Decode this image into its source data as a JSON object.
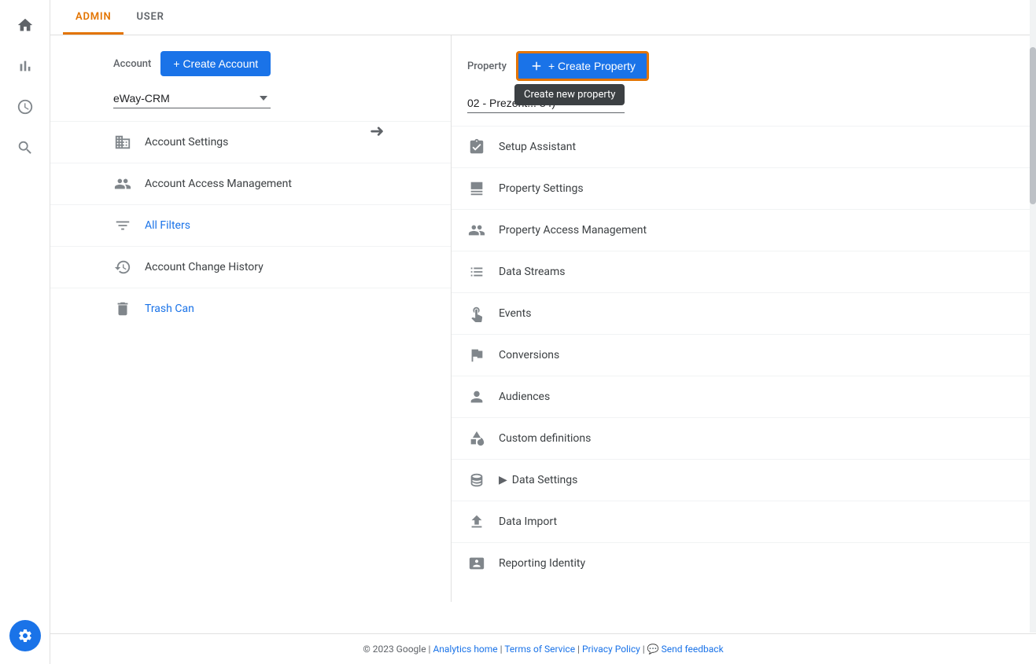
{
  "tabs": {
    "admin": "ADMIN",
    "user": "USER",
    "active": "admin"
  },
  "account_col": {
    "label": "Account",
    "create_btn": "+ Create Account",
    "dropdown_value": "eWay-CRM",
    "menu_items": [
      {
        "id": "account-settings",
        "label": "Account Settings",
        "icon": "building"
      },
      {
        "id": "account-access",
        "label": "Account Access Management",
        "icon": "people"
      },
      {
        "id": "all-filters",
        "label": "All Filters",
        "icon": "filter",
        "highlight": true
      },
      {
        "id": "account-change-history",
        "label": "Account Change History",
        "icon": "history"
      },
      {
        "id": "trash-can",
        "label": "Trash Can",
        "icon": "trash",
        "highlight": true
      }
    ]
  },
  "property_col": {
    "label": "Property",
    "create_btn": "+ Create Property",
    "tooltip": "Create new property",
    "dropdown_value": "02 - Prezent... 84)",
    "menu_items": [
      {
        "id": "setup-assistant",
        "label": "Setup Assistant",
        "icon": "clipboard"
      },
      {
        "id": "property-settings",
        "label": "Property Settings",
        "icon": "window"
      },
      {
        "id": "property-access",
        "label": "Property Access Management",
        "icon": "people"
      },
      {
        "id": "data-streams",
        "label": "Data Streams",
        "icon": "streams"
      },
      {
        "id": "events",
        "label": "Events",
        "icon": "touch"
      },
      {
        "id": "conversions",
        "label": "Conversions",
        "icon": "flag"
      },
      {
        "id": "audiences",
        "label": "Audiences",
        "icon": "person-list"
      },
      {
        "id": "custom-definitions",
        "label": "Custom definitions",
        "icon": "shapes"
      },
      {
        "id": "data-settings",
        "label": "Data Settings",
        "icon": "database",
        "has_arrow": true
      },
      {
        "id": "data-import",
        "label": "Data Import",
        "icon": "upload"
      },
      {
        "id": "reporting-identity",
        "label": "Reporting Identity",
        "icon": "id-card"
      }
    ]
  },
  "footer": {
    "copyright": "© 2023 Google",
    "links": [
      "Analytics home",
      "Terms of Service",
      "Privacy Policy"
    ],
    "feedback": "Send feedback"
  },
  "sidebar": {
    "icons": [
      "home",
      "chart",
      "clock",
      "target"
    ],
    "gear_label": "Settings"
  }
}
